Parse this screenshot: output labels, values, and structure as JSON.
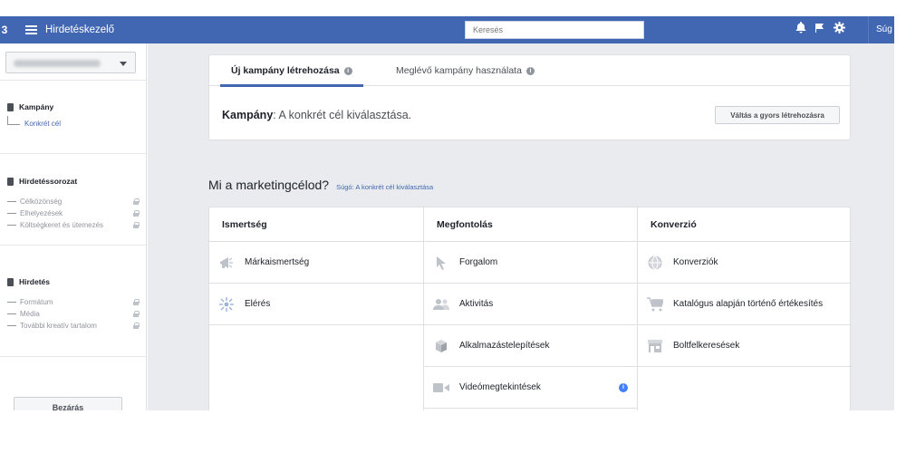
{
  "colors": {
    "topbar": "#4267b2",
    "accent": "#4267b2",
    "info_badge": "#4080ff",
    "main_bg": "#e9ebee"
  },
  "topbar": {
    "left_edge_glyph": "3",
    "app_title": "Hirdetéskezelő",
    "search_placeholder": "Keresés",
    "icons": [
      "bell-icon",
      "flag-icon",
      "gear-icon"
    ],
    "help_cut": "Súg"
  },
  "sidebar": {
    "campaign": {
      "title": "Kampány",
      "sub": "Konkrét cél"
    },
    "adset": {
      "title": "Hirdetéssorozat",
      "items": [
        "Célközönség",
        "Elhelyezések",
        "Költségkeret és ütemezés"
      ]
    },
    "ad": {
      "title": "Hirdetés",
      "items": [
        "Formátum",
        "Média",
        "További kreatív tartalom"
      ]
    },
    "close_label": "Bezárás"
  },
  "main": {
    "tabs": [
      {
        "label": "Új kampány létrehozása",
        "active": true
      },
      {
        "label": "Meglévő kampány használata",
        "active": false
      }
    ],
    "campaign_label": "Kampány",
    "campaign_text": ": A konkrét cél kiválasztása.",
    "switch_button": "Váltás a gyors létrehozásra",
    "goal_question": "Mi a marketingcélod?",
    "goal_help": "Súgó: A konkrét cél kiválasztása",
    "columns": [
      {
        "title": "Ismertség",
        "options": [
          {
            "label": "Márkaismertség",
            "icon": "megaphone-icon"
          },
          {
            "label": "Elérés",
            "icon": "reach-icon"
          }
        ]
      },
      {
        "title": "Megfontolás",
        "options": [
          {
            "label": "Forgalom",
            "icon": "cursor-icon"
          },
          {
            "label": "Aktivitás",
            "icon": "people-icon"
          },
          {
            "label": "Alkalmazástelepítések",
            "icon": "cube-icon"
          },
          {
            "label": "Videómegtekintések",
            "icon": "video-icon",
            "info": "i"
          }
        ]
      },
      {
        "title": "Konverzió",
        "options": [
          {
            "label": "Konverziók",
            "icon": "globe-icon"
          },
          {
            "label": "Katalógus alapján történő értékesítés",
            "icon": "cart-icon"
          },
          {
            "label": "Boltfelkeresések",
            "icon": "store-icon"
          }
        ]
      }
    ]
  }
}
